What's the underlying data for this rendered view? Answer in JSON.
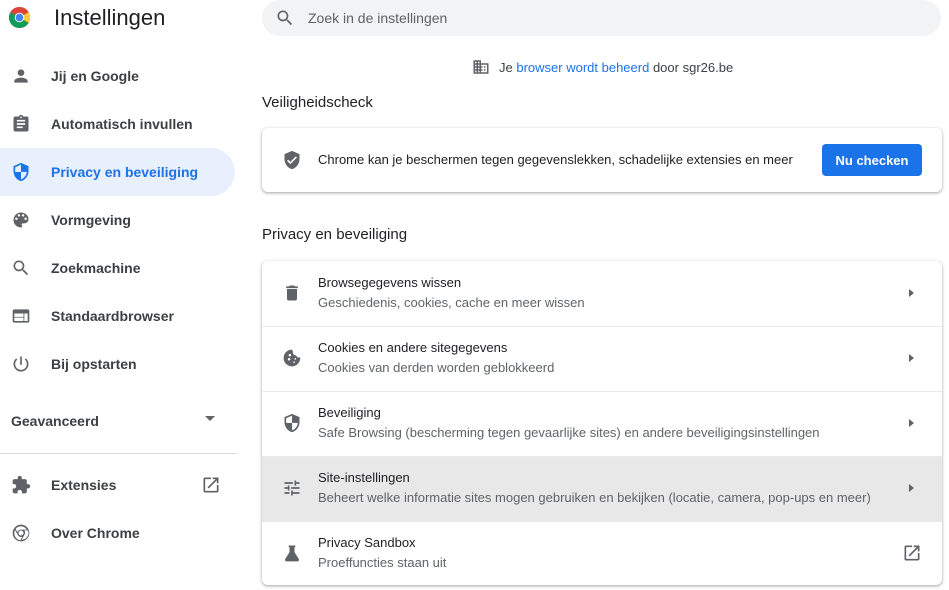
{
  "app": {
    "title": "Instellingen"
  },
  "search": {
    "placeholder": "Zoek in de instellingen"
  },
  "managed": {
    "prefix": "Je ",
    "link": "browser wordt beheerd",
    "suffix": " door sgr26.be"
  },
  "sidebar": {
    "items": [
      {
        "label": "Jij en Google",
        "icon": "person-icon"
      },
      {
        "label": "Automatisch invullen",
        "icon": "clipboard-icon"
      },
      {
        "label": "Privacy en beveiliging",
        "icon": "shield-icon",
        "active": true
      },
      {
        "label": "Vormgeving",
        "icon": "palette-icon"
      },
      {
        "label": "Zoekmachine",
        "icon": "search-icon"
      },
      {
        "label": "Standaardbrowser",
        "icon": "browser-window-icon"
      },
      {
        "label": "Bij opstarten",
        "icon": "power-icon"
      }
    ],
    "advanced_label": "Geavanceerd",
    "bottom": [
      {
        "label": "Extensies",
        "icon": "puzzle-icon"
      },
      {
        "label": "Over Chrome",
        "icon": "chrome-icon"
      }
    ]
  },
  "safety_check": {
    "heading": "Veiligheidscheck",
    "text": "Chrome kan je beschermen tegen gegevenslekken, schadelijke extensies en meer",
    "button": "Nu checken"
  },
  "privacy": {
    "heading": "Privacy en beveiliging",
    "rows": [
      {
        "title": "Browsegegevens wissen",
        "subtitle": "Geschiedenis, cookies, cache en meer wissen",
        "icon": "trash-icon"
      },
      {
        "title": "Cookies en andere sitegegevens",
        "subtitle": "Cookies van derden worden geblokkeerd",
        "icon": "cookie-icon"
      },
      {
        "title": "Beveiliging",
        "subtitle": "Safe Browsing (bescherming tegen gevaarlijke sites) en andere beveiligingsinstellingen",
        "icon": "shield-icon"
      },
      {
        "title": "Site-instellingen",
        "subtitle": "Beheert welke informatie sites mogen gebruiken en bekijken (locatie, camera, pop-ups en meer)",
        "icon": "sliders-icon"
      },
      {
        "title": "Privacy Sandbox",
        "subtitle": "Proeffuncties staan uit",
        "icon": "flask-icon"
      }
    ]
  },
  "colors": {
    "accent": "#1a73e8",
    "active_bg": "#e8f0fe",
    "hover_row": "#e8e8e8",
    "icon_gray": "#5f6368"
  }
}
